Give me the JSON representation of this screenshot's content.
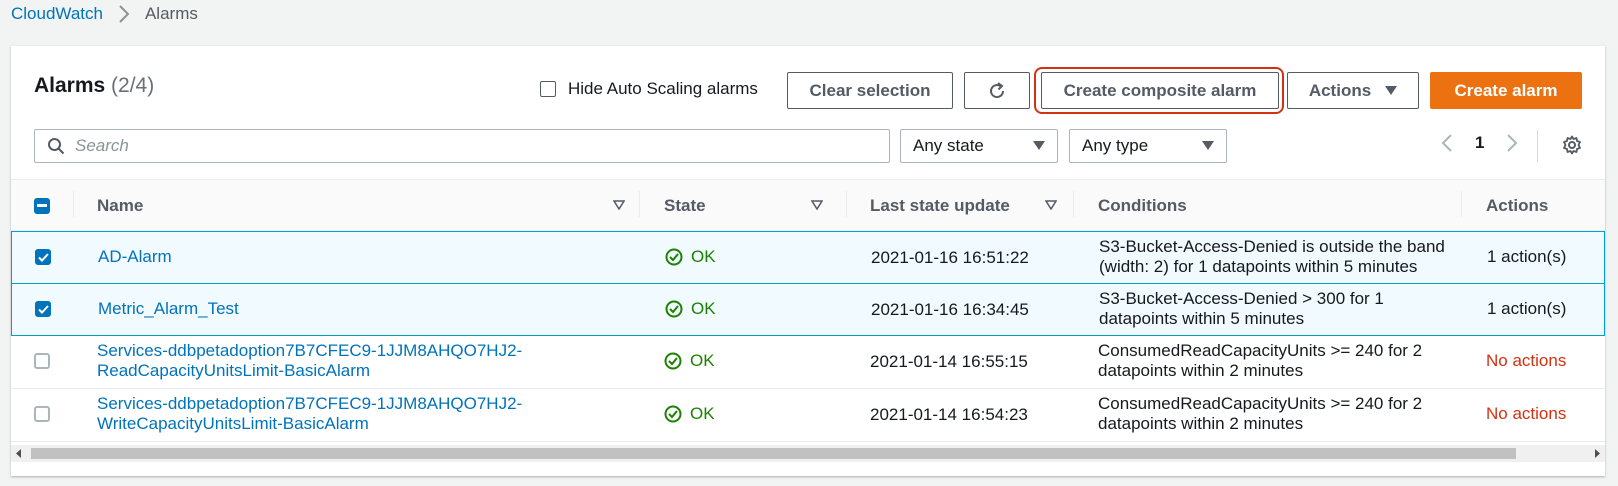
{
  "breadcrumb": {
    "root": "CloudWatch",
    "current": "Alarms"
  },
  "header": {
    "title": "Alarms",
    "count": "(2/4)",
    "hide_autoscaling_label": "Hide Auto Scaling alarms",
    "clear_selection": "Clear selection",
    "create_composite": "Create composite alarm",
    "actions": "Actions",
    "create_alarm": "Create alarm"
  },
  "filters": {
    "search_placeholder": "Search",
    "state_select": "Any state",
    "type_select": "Any type",
    "page": "1"
  },
  "columns": {
    "name": "Name",
    "state": "State",
    "last_update": "Last state update",
    "conditions": "Conditions",
    "actions": "Actions"
  },
  "rows": [
    {
      "name1": "AD-Alarm",
      "name2": "",
      "state": "OK",
      "updated": "2021-01-16 16:51:22",
      "cond1": "S3-Bucket-Access-Denied is outside the band",
      "cond2": "(width: 2) for 1 datapoints within 5 minutes",
      "actions": "1 action(s)"
    },
    {
      "name1": "Metric_Alarm_Test",
      "name2": "",
      "state": "OK",
      "updated": "2021-01-16 16:34:45",
      "cond1": "S3-Bucket-Access-Denied > 300 for 1",
      "cond2": "datapoints within 5 minutes",
      "actions": "1 action(s)"
    },
    {
      "name1": "Services-ddbpetadoption7B7CFEC9-1JJM8AHQO7HJ2-",
      "name2": "ReadCapacityUnitsLimit-BasicAlarm",
      "state": "OK",
      "updated": "2021-01-14 16:55:15",
      "cond1": "ConsumedReadCapacityUnits >= 240 for 2",
      "cond2": "datapoints within 2 minutes",
      "actions": "No actions"
    },
    {
      "name1": "Services-ddbpetadoption7B7CFEC9-1JJM8AHQO7HJ2-",
      "name2": "WriteCapacityUnitsLimit-BasicAlarm",
      "state": "OK",
      "updated": "2021-01-14 16:54:23",
      "cond1": "ConsumedReadCapacityUnits >= 240 for 2",
      "cond2": "datapoints within 2 minutes",
      "actions": "No actions"
    }
  ],
  "colors": {
    "link": "#0073bb",
    "ok": "#1d8102",
    "primary": "#ec7211",
    "highlight": "#d13212",
    "selected_bg": "#f1faff"
  }
}
